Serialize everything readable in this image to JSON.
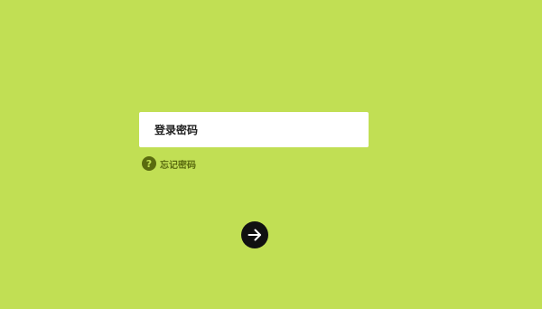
{
  "colors": {
    "background": "#c1df54",
    "input_background": "#ffffff",
    "accent_dark": "#5a6b0f",
    "button": "#111111"
  },
  "login": {
    "password_placeholder": "登录密码",
    "password_value": "",
    "forgot_label": "忘记密码",
    "help_icon_glyph": "?",
    "help_icon_name": "help-icon",
    "submit_icon_name": "arrow-right-icon"
  }
}
